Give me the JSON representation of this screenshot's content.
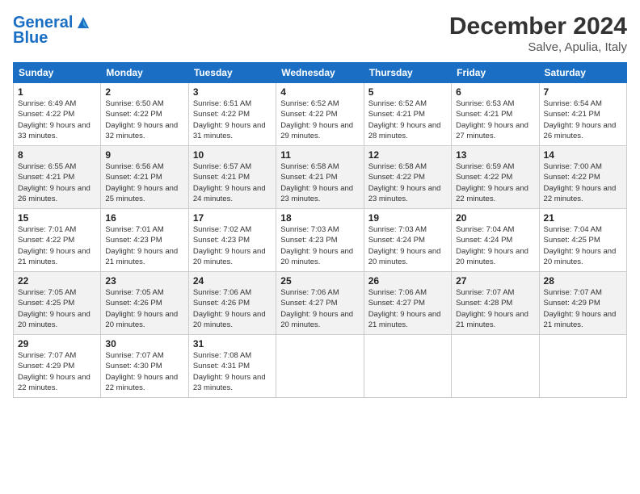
{
  "header": {
    "logo_line1": "General",
    "logo_line2": "Blue",
    "month": "December 2024",
    "location": "Salve, Apulia, Italy"
  },
  "weekdays": [
    "Sunday",
    "Monday",
    "Tuesday",
    "Wednesday",
    "Thursday",
    "Friday",
    "Saturday"
  ],
  "weeks": [
    [
      {
        "day": "1",
        "sunrise": "6:49 AM",
        "sunset": "4:22 PM",
        "daylight": "9 hours and 33 minutes."
      },
      {
        "day": "2",
        "sunrise": "6:50 AM",
        "sunset": "4:22 PM",
        "daylight": "9 hours and 32 minutes."
      },
      {
        "day": "3",
        "sunrise": "6:51 AM",
        "sunset": "4:22 PM",
        "daylight": "9 hours and 31 minutes."
      },
      {
        "day": "4",
        "sunrise": "6:52 AM",
        "sunset": "4:22 PM",
        "daylight": "9 hours and 29 minutes."
      },
      {
        "day": "5",
        "sunrise": "6:52 AM",
        "sunset": "4:21 PM",
        "daylight": "9 hours and 28 minutes."
      },
      {
        "day": "6",
        "sunrise": "6:53 AM",
        "sunset": "4:21 PM",
        "daylight": "9 hours and 27 minutes."
      },
      {
        "day": "7",
        "sunrise": "6:54 AM",
        "sunset": "4:21 PM",
        "daylight": "9 hours and 26 minutes."
      }
    ],
    [
      {
        "day": "8",
        "sunrise": "6:55 AM",
        "sunset": "4:21 PM",
        "daylight": "9 hours and 26 minutes."
      },
      {
        "day": "9",
        "sunrise": "6:56 AM",
        "sunset": "4:21 PM",
        "daylight": "9 hours and 25 minutes."
      },
      {
        "day": "10",
        "sunrise": "6:57 AM",
        "sunset": "4:21 PM",
        "daylight": "9 hours and 24 minutes."
      },
      {
        "day": "11",
        "sunrise": "6:58 AM",
        "sunset": "4:21 PM",
        "daylight": "9 hours and 23 minutes."
      },
      {
        "day": "12",
        "sunrise": "6:58 AM",
        "sunset": "4:22 PM",
        "daylight": "9 hours and 23 minutes."
      },
      {
        "day": "13",
        "sunrise": "6:59 AM",
        "sunset": "4:22 PM",
        "daylight": "9 hours and 22 minutes."
      },
      {
        "day": "14",
        "sunrise": "7:00 AM",
        "sunset": "4:22 PM",
        "daylight": "9 hours and 22 minutes."
      }
    ],
    [
      {
        "day": "15",
        "sunrise": "7:01 AM",
        "sunset": "4:22 PM",
        "daylight": "9 hours and 21 minutes."
      },
      {
        "day": "16",
        "sunrise": "7:01 AM",
        "sunset": "4:23 PM",
        "daylight": "9 hours and 21 minutes."
      },
      {
        "day": "17",
        "sunrise": "7:02 AM",
        "sunset": "4:23 PM",
        "daylight": "9 hours and 20 minutes."
      },
      {
        "day": "18",
        "sunrise": "7:03 AM",
        "sunset": "4:23 PM",
        "daylight": "9 hours and 20 minutes."
      },
      {
        "day": "19",
        "sunrise": "7:03 AM",
        "sunset": "4:24 PM",
        "daylight": "9 hours and 20 minutes."
      },
      {
        "day": "20",
        "sunrise": "7:04 AM",
        "sunset": "4:24 PM",
        "daylight": "9 hours and 20 minutes."
      },
      {
        "day": "21",
        "sunrise": "7:04 AM",
        "sunset": "4:25 PM",
        "daylight": "9 hours and 20 minutes."
      }
    ],
    [
      {
        "day": "22",
        "sunrise": "7:05 AM",
        "sunset": "4:25 PM",
        "daylight": "9 hours and 20 minutes."
      },
      {
        "day": "23",
        "sunrise": "7:05 AM",
        "sunset": "4:26 PM",
        "daylight": "9 hours and 20 minutes."
      },
      {
        "day": "24",
        "sunrise": "7:06 AM",
        "sunset": "4:26 PM",
        "daylight": "9 hours and 20 minutes."
      },
      {
        "day": "25",
        "sunrise": "7:06 AM",
        "sunset": "4:27 PM",
        "daylight": "9 hours and 20 minutes."
      },
      {
        "day": "26",
        "sunrise": "7:06 AM",
        "sunset": "4:27 PM",
        "daylight": "9 hours and 21 minutes."
      },
      {
        "day": "27",
        "sunrise": "7:07 AM",
        "sunset": "4:28 PM",
        "daylight": "9 hours and 21 minutes."
      },
      {
        "day": "28",
        "sunrise": "7:07 AM",
        "sunset": "4:29 PM",
        "daylight": "9 hours and 21 minutes."
      }
    ],
    [
      {
        "day": "29",
        "sunrise": "7:07 AM",
        "sunset": "4:29 PM",
        "daylight": "9 hours and 22 minutes."
      },
      {
        "day": "30",
        "sunrise": "7:07 AM",
        "sunset": "4:30 PM",
        "daylight": "9 hours and 22 minutes."
      },
      {
        "day": "31",
        "sunrise": "7:08 AM",
        "sunset": "4:31 PM",
        "daylight": "9 hours and 23 minutes."
      },
      null,
      null,
      null,
      null
    ]
  ]
}
